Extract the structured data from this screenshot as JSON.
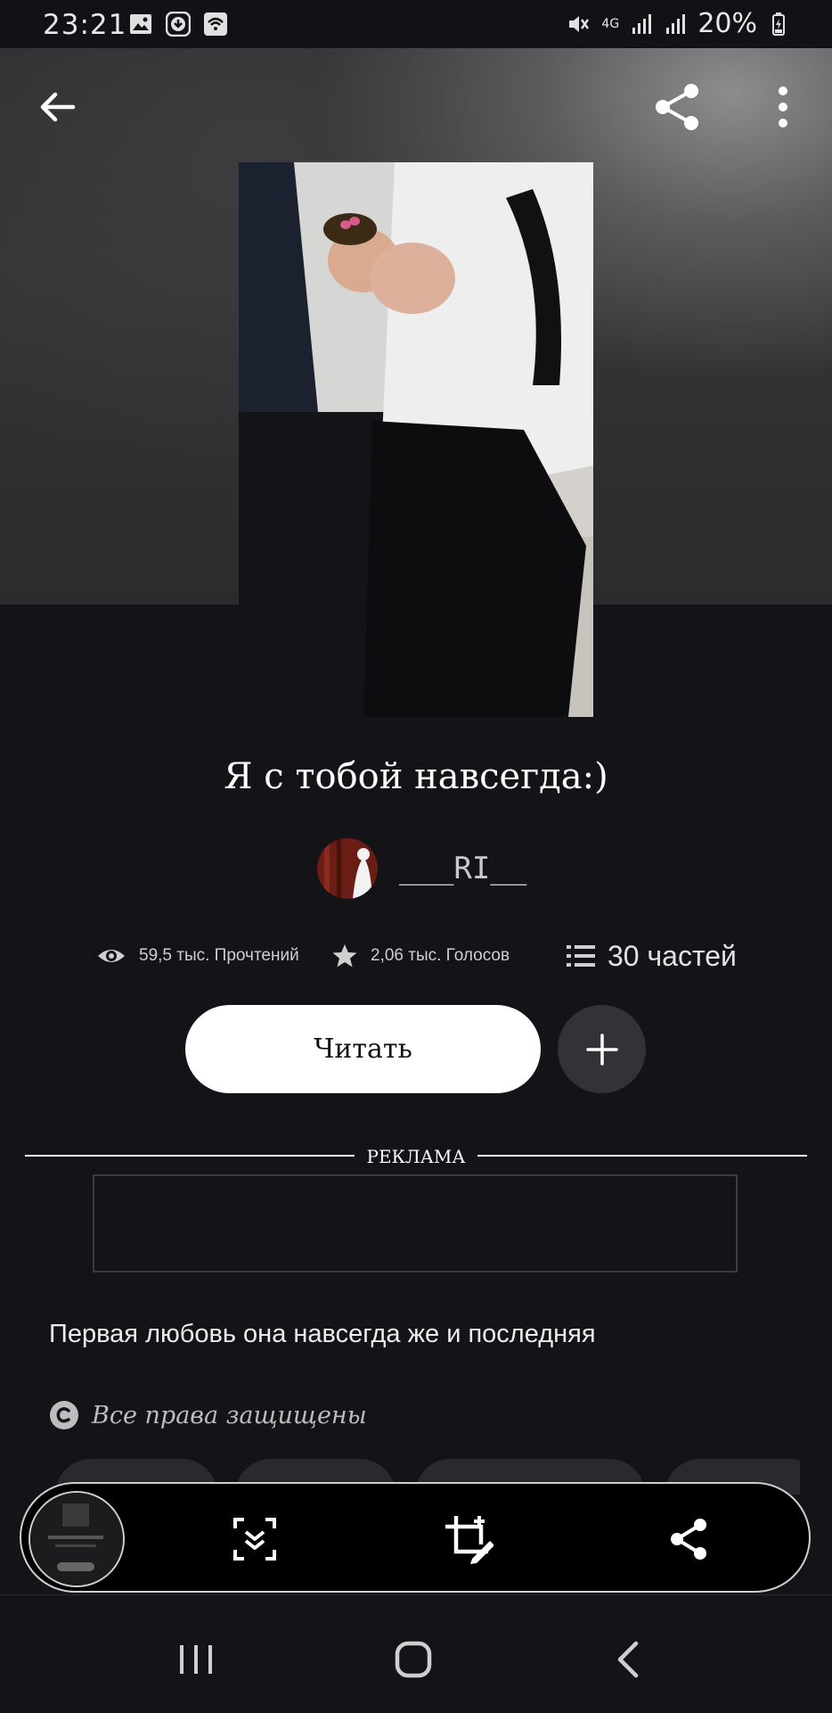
{
  "status_bar": {
    "time": "23:21",
    "battery": "20%",
    "network": "4G",
    "icons": [
      "gallery-icon",
      "download-icon",
      "wifi-calling-icon",
      "mute-icon",
      "signal-icon",
      "battery-charging-icon"
    ]
  },
  "toolbar": {
    "back_icon": "arrow-left-icon",
    "share_icon": "share-icon",
    "more_icon": "more-vertical-icon"
  },
  "story": {
    "title": "Я с тобой навсегда:)",
    "author": "___RI__",
    "reads": "59,5 тыс. Прочтений",
    "votes": "2,06 тыс. Голосов",
    "parts": "30 частей",
    "read_button": "Читать",
    "description": "Первая любовь она  навсегда же и последняя",
    "copyright": "Все права защищены"
  },
  "ad": {
    "label": "РЕКЛАМА"
  },
  "colors": {
    "background": "#141317",
    "button_bg": "#ffffff",
    "add_button_bg": "#333236"
  },
  "capture_toolbar": {
    "icons": [
      "scroll-capture-icon",
      "crop-edit-icon",
      "share-icon"
    ]
  },
  "system_nav": {
    "icons": [
      "recent-apps-icon",
      "home-icon",
      "back-icon"
    ]
  }
}
